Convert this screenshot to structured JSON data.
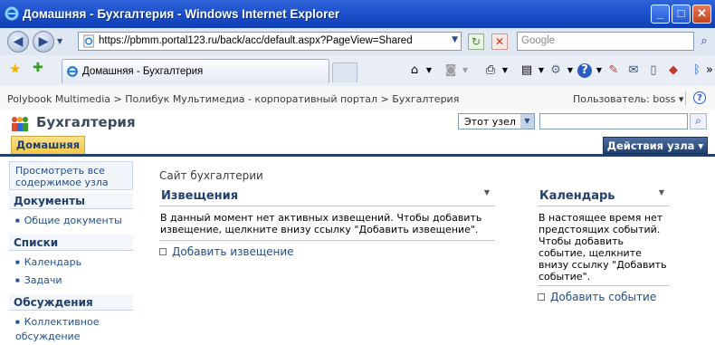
{
  "window": {
    "title": "Домашняя - Бухгалтерия - Windows Internet Explorer",
    "min": "_",
    "max": "□",
    "close": "✕"
  },
  "browser": {
    "url": "https://pbmm.portal123.ru/back/acc/default.aspx?PageView=Shared",
    "search_placeholder": "Google",
    "tab_label": "Домашняя - Бухгалтерия"
  },
  "breadcrumb": {
    "text": "Polybook Multimedia > Полибук Мультимедиа - корпоративный портал > Бухгалтерия",
    "user": "Пользователь: boss ▾"
  },
  "site": {
    "title": "Бухгалтерия",
    "scope": "Этот узел",
    "home_tab": "Домашняя",
    "site_actions": "Действия узла ▾"
  },
  "leftnav": {
    "view_all": "Просмотреть все содержимое узла",
    "sections": [
      {
        "header": "Документы",
        "items": [
          "Общие документы"
        ]
      },
      {
        "header": "Списки",
        "items": [
          "Календарь",
          "Задачи"
        ]
      },
      {
        "header": "Обсуждения",
        "items": [
          "Коллективное обсуждение"
        ]
      }
    ]
  },
  "main": {
    "page_header": "Сайт бухгалтерии",
    "announcements": {
      "title": "Извещения",
      "body": "В данный момент нет активных извещений. Чтобы добавить извещение, щелкните внизу ссылку \"Добавить извещение\".",
      "add": "Добавить извещение"
    },
    "calendar": {
      "title": "Календарь",
      "body": "В настоящее время нет предстоящих событий. Чтобы добавить событие, щелкните внизу ссылку \"Добавить событие\".",
      "add": "Добавить событие"
    }
  },
  "colors": {
    "titlebar": "#1f54cf",
    "nav_accent": "#21406e",
    "link": "#1f4e8c",
    "home_tab": "#f3c847"
  }
}
